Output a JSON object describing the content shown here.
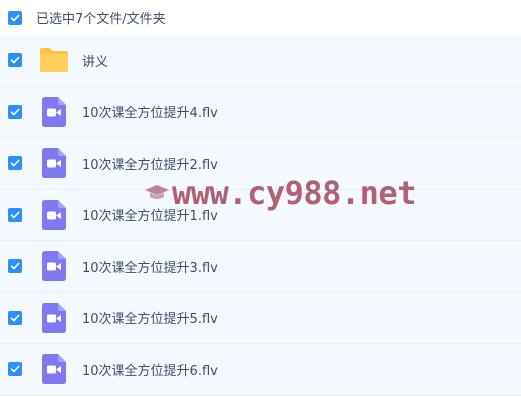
{
  "header": {
    "selected_label": "已选中7个文件/文件夹"
  },
  "files": [
    {
      "name": "讲义",
      "type": "folder"
    },
    {
      "name": "10次课全方位提升4.flv",
      "type": "video"
    },
    {
      "name": "10次课全方位提升2.flv",
      "type": "video"
    },
    {
      "name": "10次课全方位提升1.flv",
      "type": "video"
    },
    {
      "name": "10次课全方位提升3.flv",
      "type": "video"
    },
    {
      "name": "10次课全方位提升5.flv",
      "type": "video"
    },
    {
      "name": "10次课全方位提升6.flv",
      "type": "video"
    }
  ],
  "watermark": {
    "text": "www.cy988.net"
  },
  "colors": {
    "accent": "#2f8ff8",
    "folder": "#fdc444",
    "video": "#7f78f0",
    "row_bg": "#f3f9fe"
  }
}
